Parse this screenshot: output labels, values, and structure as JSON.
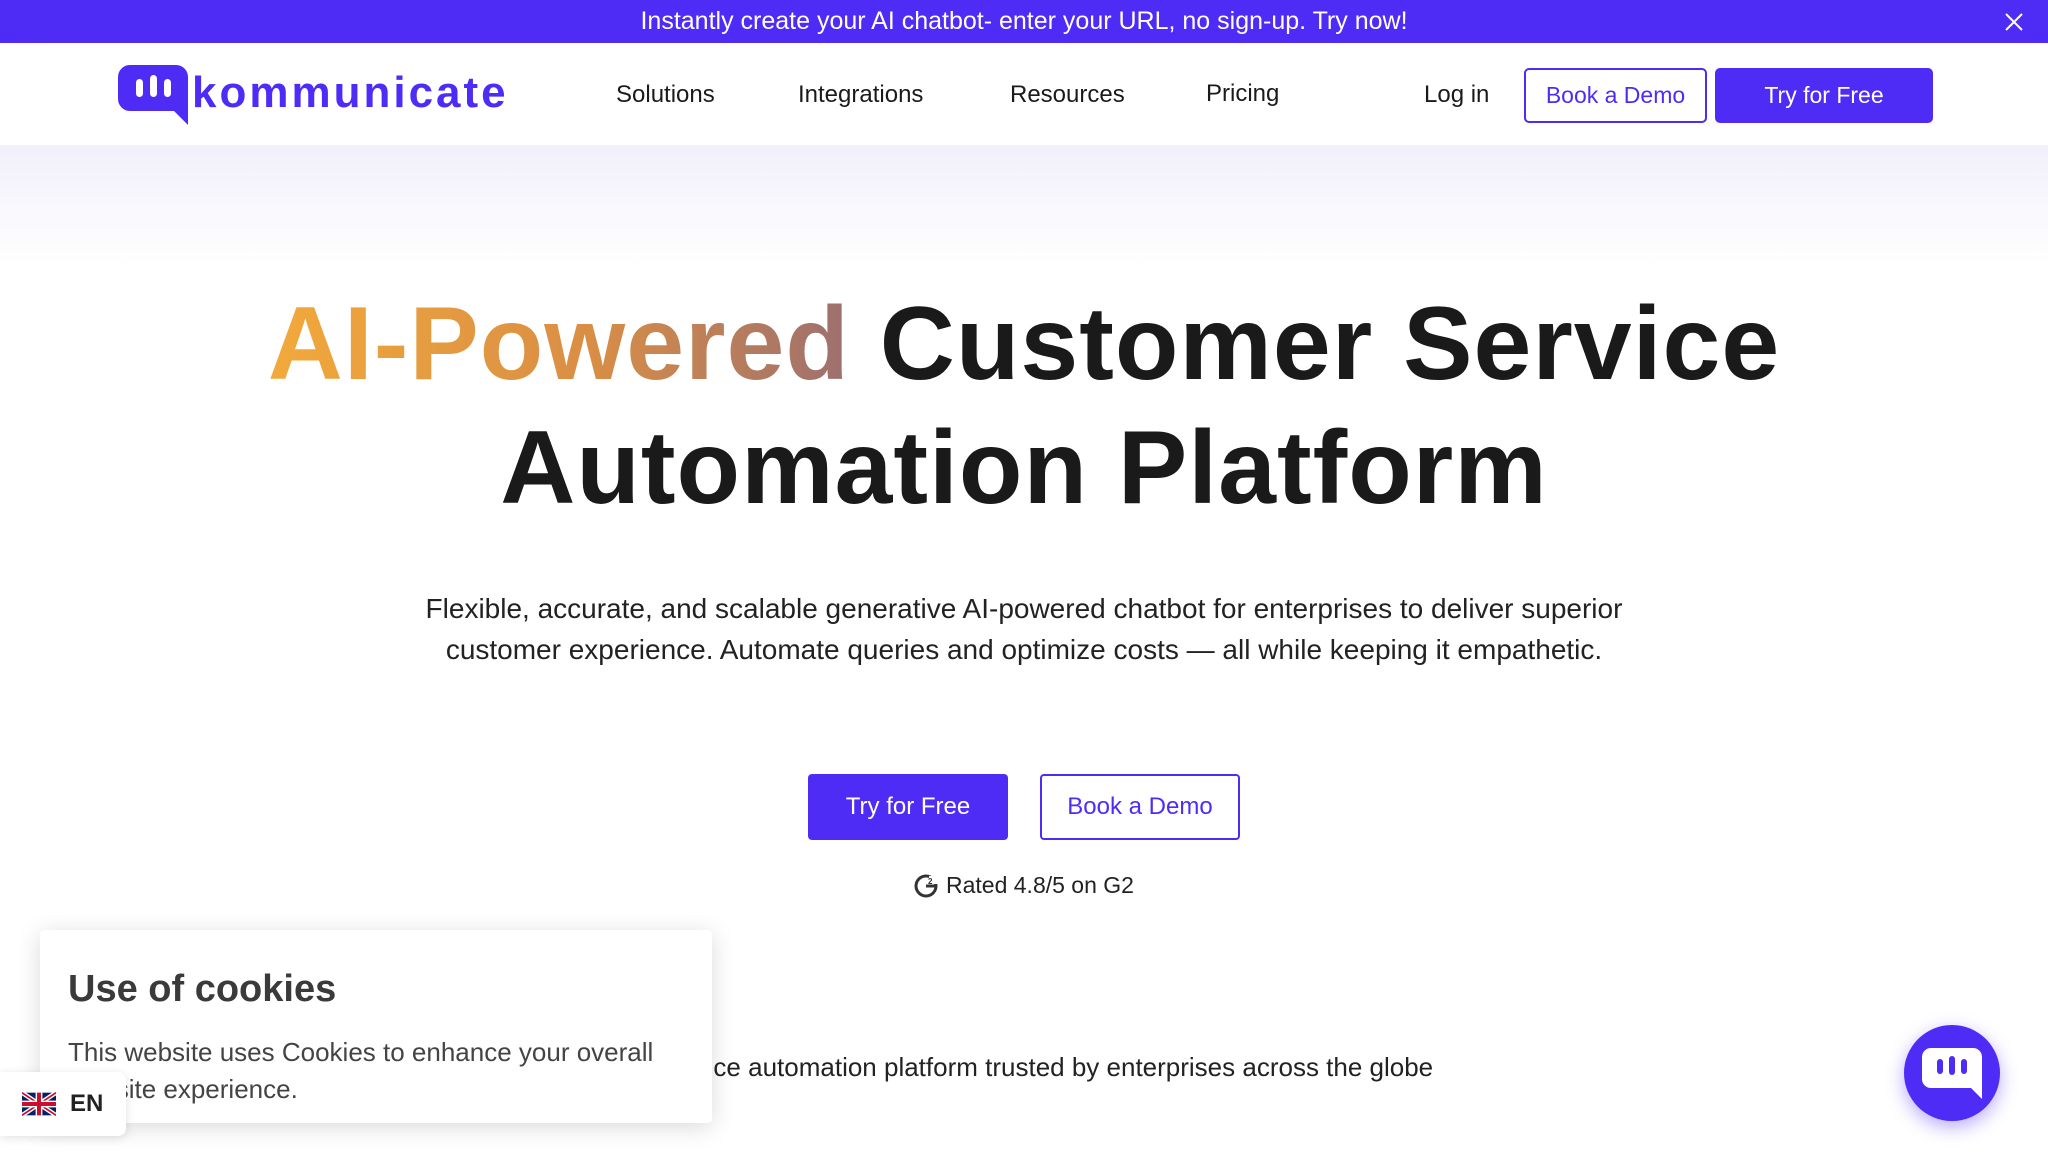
{
  "announcement": {
    "text": "Instantly create your AI chatbot- enter your URL, no sign-up. Try now!"
  },
  "header": {
    "logo_text": "kommunicate",
    "nav": [
      "Solutions",
      "Integrations",
      "Resources",
      "Pricing"
    ],
    "login_label": "Log in",
    "book_demo_label": "Book a Demo",
    "try_free_label": "Try for Free"
  },
  "hero": {
    "title_highlight": "AI-Powered",
    "title_rest_line1": "Customer Service",
    "title_line2": "Automation Platform",
    "subtitle": "Flexible, accurate, and scalable generative AI-powered chatbot for enterprises to deliver superior customer experience. Automate queries and optimize costs — all while keeping it empathetic.",
    "try_free_label": "Try for Free",
    "book_demo_label": "Book a Demo",
    "rating_text": "Rated 4.8/5 on G2",
    "trusted_text": "rvice automation platform trusted by enterprises across the globe"
  },
  "cookie": {
    "title": "Use of cookies",
    "body": "This website uses Cookies to enhance your overall website experience."
  },
  "language": {
    "code": "EN"
  },
  "colors": {
    "brand": "#4f2cf6",
    "gradient_start": "#f2a93b",
    "gradient_end": "#9c6f70"
  },
  "icons": {
    "close": "close-icon",
    "logo": "kommunicate-logo-icon",
    "g2": "g2-icon",
    "flag": "uk-flag-icon",
    "chat": "chat-launcher-icon"
  }
}
